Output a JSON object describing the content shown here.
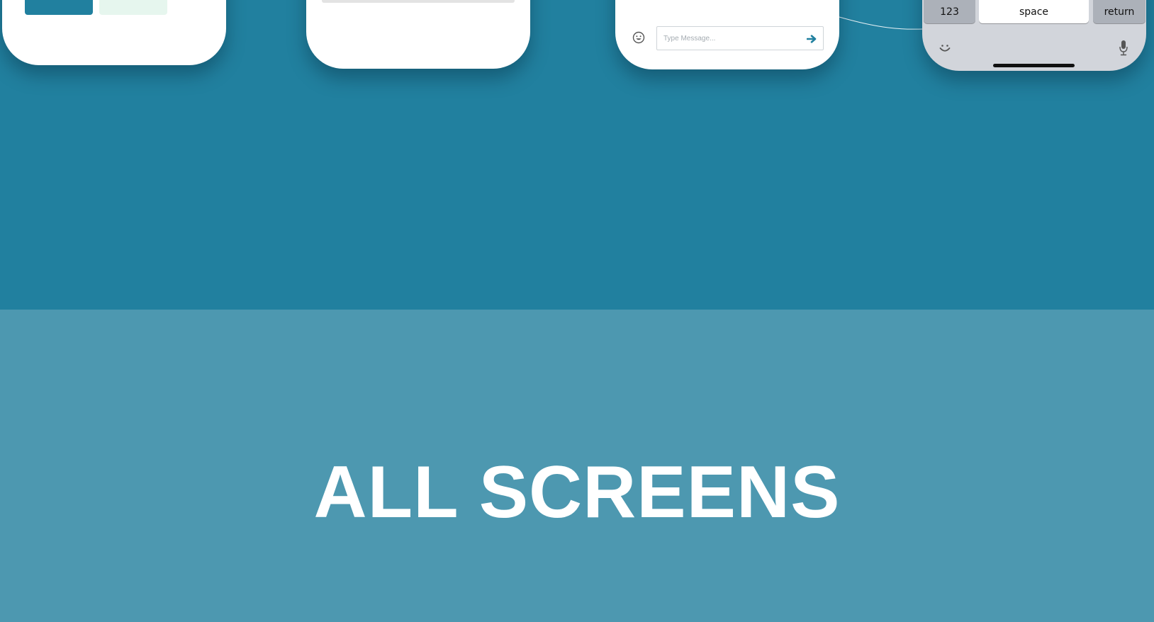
{
  "colors": {
    "top_background": "#21809f",
    "bottom_background": "#4d98b0",
    "primary_button": "#21809f",
    "secondary_button": "#e6f6ee",
    "keyboard": "#d2d5db",
    "headline_text": "#ffffff"
  },
  "chat": {
    "message_placeholder": "Type Message...",
    "emoji_icon": "smiley-icon",
    "send_icon": "arrow-right-icon"
  },
  "keyboard": {
    "key_numbers": "123",
    "key_space": "space",
    "key_return": "return",
    "emoji_icon": "emoji-icon",
    "mic_icon": "microphone-icon"
  },
  "section": {
    "title": "ALL SCREENS"
  }
}
